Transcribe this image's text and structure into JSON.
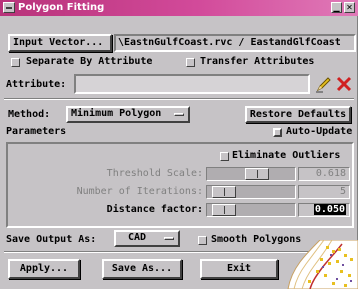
{
  "window": {
    "title": "Polygon Fitting"
  },
  "input": {
    "button_label": "Input Vector...",
    "path": "\\EastnGulfCoast.rvc / EastandGlfCoast"
  },
  "options": {
    "separate_by_attribute": "Separate By Attribute",
    "transfer_attributes": "Transfer Attributes"
  },
  "attribute": {
    "label": "Attribute:",
    "value": ""
  },
  "method": {
    "label": "Method:",
    "selected": "Minimum Polygon",
    "restore_label": "Restore Defaults"
  },
  "parameters": {
    "heading": "Parameters",
    "auto_update": "Auto-Update",
    "eliminate_outliers": "Eliminate Outliers",
    "rows": [
      {
        "label": "Threshold Scale:",
        "value": "0.618",
        "level": 0.6,
        "enabled": false
      },
      {
        "label": "Number of Iterations:",
        "value": "5",
        "level": 0.08,
        "enabled": false
      },
      {
        "label": "Distance factor:",
        "value": "0.050",
        "level": 0.08,
        "enabled": true
      }
    ]
  },
  "save": {
    "label": "Save Output As:",
    "selected": "CAD",
    "smooth_polygons": "Smooth Polygons"
  },
  "footer": {
    "apply": "Apply...",
    "save_as": "Save As...",
    "exit": "Exit"
  },
  "colors": {
    "title_bar": "#c23c88",
    "face": "#c6c3c6",
    "pencil": "#e6c020",
    "delete_x": "#d02020"
  }
}
